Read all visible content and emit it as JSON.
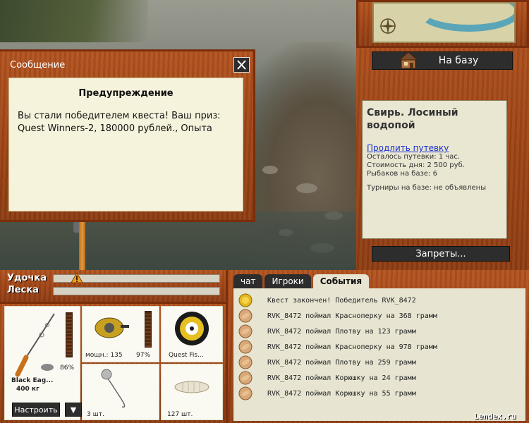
{
  "dialog": {
    "title": "Сообщение",
    "heading": "Предупреждение",
    "text": "Вы стали победителем квеста! Ваш приз: Quest Winners-2, 180000 рублей., Опыта"
  },
  "base_button": "На базу",
  "location": {
    "title": "Свирь. Лосиный водопой",
    "extend_link": "Продлить путевку",
    "remaining": "Осталось путевки: 1 час.",
    "day_cost": "Стоимость дня: 2 500 руб.",
    "fishers": "Рыбаков на базе: 6",
    "tournaments": "Турниры на базе: не объявлены"
  },
  "prohibitions_button": "Запреты...",
  "bars": {
    "rod_label": "Удочка",
    "line_label": "Леска"
  },
  "inventory": {
    "rod_name": "Black Eag...",
    "rod_weight": "400 кг",
    "rod_percent": "86%",
    "reel_power": "мощн.: 135",
    "reel_percent": "97%",
    "line_name": "Quest Fis...",
    "hook_count": "3 шт.",
    "bait_count": "127 шт.",
    "setup_button": "Настроить",
    "down_button": "▼"
  },
  "chat": {
    "tabs": [
      "чат",
      "Игроки",
      "События"
    ],
    "events": [
      "Квест закончен! Победитель RVK_8472",
      "RVK_8472 поймал Красноперку на 368 грамм",
      "RVK_8472 поймал Плотву на 123 грамм",
      "RVK_8472 поймал Красноперку на 978 грамм",
      "RVK_8472 поймал Плотву на 259 грамм",
      "RVK_8472 поймал Корюшку на 24 грамм",
      "RVK_8472 поймал Корюшку на 55 грамм"
    ]
  },
  "watermark": "Lendex.ru",
  "colors": {
    "wood": "#a04516",
    "panel": "#e9e6d2",
    "button": "#2d2d2d",
    "link": "#1a33cc"
  }
}
